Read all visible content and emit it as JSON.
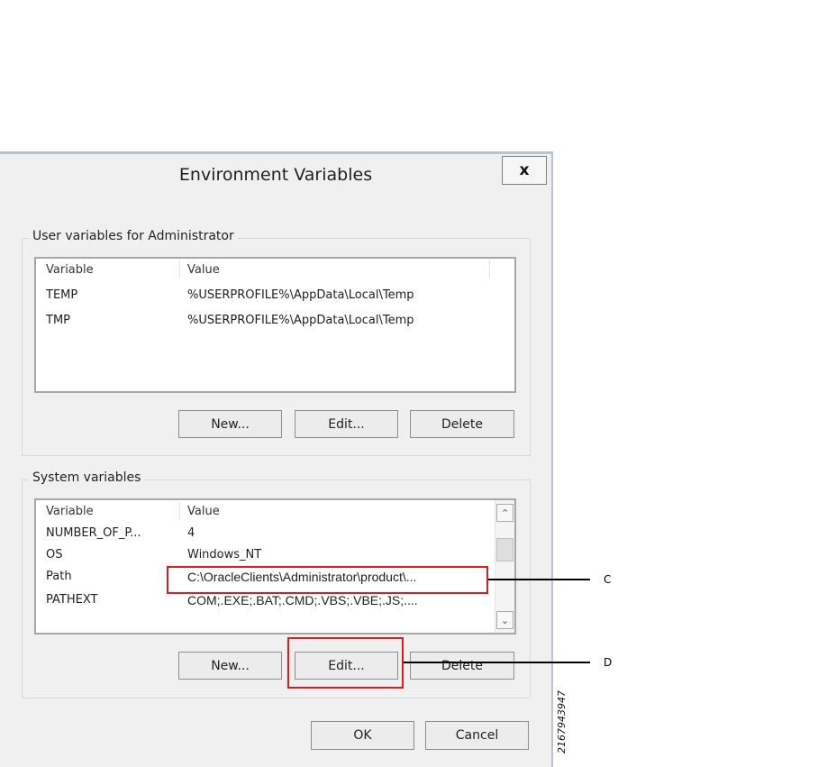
{
  "dialog": {
    "title": "Environment Variables",
    "close_label": "x"
  },
  "user_vars": {
    "group_title": "User variables for Administrator",
    "headers": {
      "variable": "Variable",
      "value": "Value"
    },
    "rows": [
      {
        "variable": "TEMP",
        "value": "%USERPROFILE%\\AppData\\Local\\Temp"
      },
      {
        "variable": "TMP",
        "value": "%USERPROFILE%\\AppData\\Local\\Temp"
      }
    ],
    "buttons": {
      "new": "New...",
      "edit": "Edit...",
      "delete": "Delete"
    }
  },
  "system_vars": {
    "group_title": "System variables",
    "headers": {
      "variable": "Variable",
      "value": "Value"
    },
    "rows": [
      {
        "variable": "NUMBER_OF_P...",
        "value": "4"
      },
      {
        "variable": "OS",
        "value": "Windows_NT"
      },
      {
        "variable": "Path",
        "value": "C:\\OracleClients\\Administrator\\product\\..."
      },
      {
        "variable": "PATHEXT",
        "value": "COM;.EXE;.BAT;.CMD;.VBS;.VBE;.JS;...."
      }
    ],
    "buttons": {
      "new": "New...",
      "edit": "Edit...",
      "delete": "Delete"
    }
  },
  "footer": {
    "ok": "OK",
    "cancel": "Cancel"
  },
  "annotations": {
    "c": "C",
    "d": "D",
    "figure_id": "216794394​7"
  },
  "colors": {
    "highlight": "#e01b1b",
    "frame": "#b8c4d3"
  }
}
